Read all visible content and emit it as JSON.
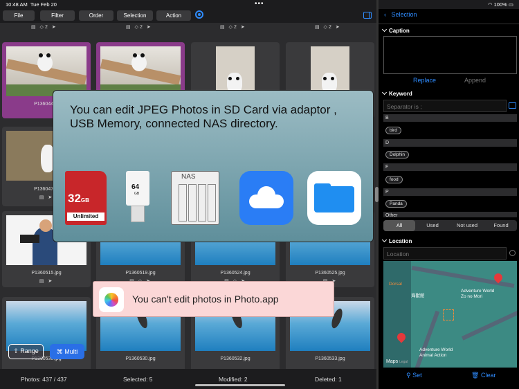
{
  "status": {
    "time": "10:48 AM",
    "date": "Tue Feb 20",
    "battery": "100%"
  },
  "toolbar": {
    "file": "File",
    "filter": "Filter",
    "order": "Order",
    "selection": "Selection",
    "action": "Action"
  },
  "grid": {
    "top_row_tags": "2",
    "row2": [
      "P13604451",
      "",
      "",
      ""
    ],
    "row3": [
      "P13604731",
      "",
      "",
      ""
    ],
    "row4": [
      "P1360515.jpg",
      "P1360519.jpg",
      "P1360524.jpg",
      "P1360525.jpg"
    ],
    "row5": [
      "P1360530.jpg",
      "P1360530.jpg",
      "P1360532.jpg",
      "P1360533.jpg"
    ]
  },
  "popup": {
    "message": "You can edit JPEG Photos in SD Card via adaptor , USB Memory, connected NAS directory.",
    "sd_size": "32",
    "sd_unit": "GB",
    "sd_label": "Unlimited",
    "usb_size": "64",
    "usb_unit": "GB",
    "nas_label": "NAS"
  },
  "toast": {
    "message": "You can't edit photos in Photo.app"
  },
  "buttons": {
    "range": "Range",
    "multi": "Multi"
  },
  "bottom": {
    "photos": "Photos: 437 / 437",
    "selected": "Selected: 5",
    "modified": "Modified: 2",
    "deleted": "Deleted: 1"
  },
  "right": {
    "selection": "Selection",
    "caption": "Caption",
    "replace": "Replace",
    "append": "Append",
    "keyword": "Keyword",
    "separator_placeholder": "Separator is ;",
    "sections": [
      {
        "letter": "B",
        "tag": "bird"
      },
      {
        "letter": "D",
        "tag": "Dolphin"
      },
      {
        "letter": "F",
        "tag": "food"
      },
      {
        "letter": "P",
        "tag": "Panda"
      },
      {
        "letter": "Other",
        "tag": ""
      }
    ],
    "segments": [
      "All",
      "Used",
      "Not used",
      "Found"
    ],
    "location": "Location",
    "location_placeholder": "Location",
    "map": {
      "label1": "Adventure World",
      "label1b": "Zo no Mori",
      "label2": "Adventure World",
      "label2b": "Animal Action",
      "label3": "海獣館",
      "label4": "Dorsal",
      "maps": "Maps",
      "legal": "Legal"
    },
    "set": "Set",
    "clear": "Clear"
  },
  "colors": {
    "accent": "#2f8cff",
    "selected_cell": "#8a3b8a",
    "toast_bg": "#fbd7d7"
  }
}
